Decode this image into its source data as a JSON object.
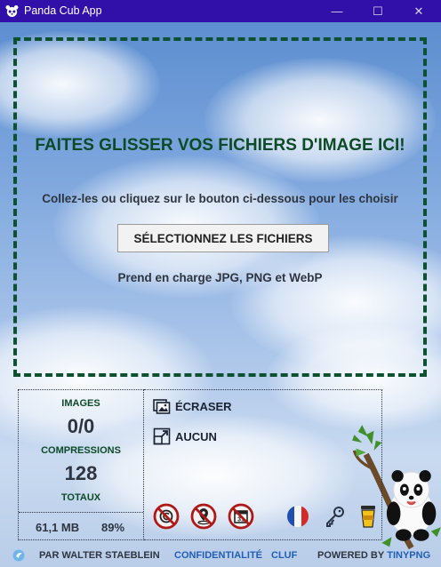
{
  "window": {
    "title": "Panda Cub App",
    "minimize_glyph": "—",
    "maximize_glyph": "☐",
    "close_glyph": "✕"
  },
  "dropzone": {
    "title": "FAITES GLISSER VOS FICHIERS D'IMAGE ICI!",
    "subtitle": "Collez-les ou cliquez sur le bouton ci-dessous pour les choisir",
    "button_label": "SÉLECTIONNEZ LES FICHIERS",
    "formats": "Prend en charge JPG, PNG et WebP"
  },
  "stats": {
    "images_label": "IMAGES",
    "images_value": "0/0",
    "compressions_label": "COMPRESSIONS",
    "compressions_value": "128",
    "totals_label": "TOTAUX",
    "total_size": "61,1 MB",
    "total_percent": "89%"
  },
  "options": {
    "overwrite_label": "ÉCRASER",
    "resize_label": "AUCUN"
  },
  "icons": {
    "no_metadata": "no-copyright-icon",
    "no_location": "no-location-icon",
    "no_date": "no-calendar-icon",
    "language": "french-flag-icon",
    "api_key": "key-icon",
    "coffee": "coffee-cup-icon"
  },
  "footer": {
    "author": "PAR WALTER STAEBLEIN",
    "privacy": "CONFIDENTIALITÉ",
    "eula": "CLUF",
    "powered_prefix": "POWERED BY",
    "powered_brand": "TINYPNG"
  },
  "colors": {
    "titlebar": "#3010a8",
    "dropzone_border": "#0d5230",
    "label_green": "#0d4a28",
    "link_blue": "#1f5fb8",
    "prohibition_red": "#b01818"
  }
}
